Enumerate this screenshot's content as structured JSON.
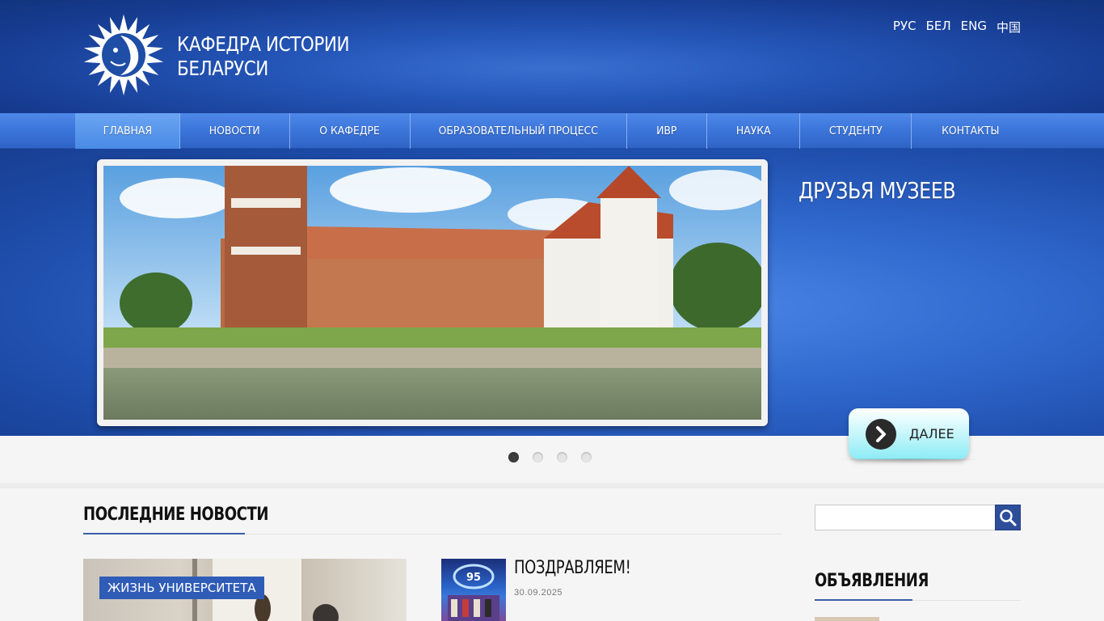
{
  "header": {
    "title_line1": "КАФЕДРА ИСТОРИИ",
    "title_line2": "БЕЛАРУСИ",
    "logo_icon": "sun-face-emblem-icon",
    "languages": [
      "РУС",
      "БЕЛ",
      "ENG",
      "中国"
    ]
  },
  "nav": {
    "items": [
      {
        "label": "ГЛАВНАЯ",
        "active": true
      },
      {
        "label": "НОВОСТИ"
      },
      {
        "label": "О КАФЕДРЕ"
      },
      {
        "label": "ОБРАЗОВАТЕЛЬНЫЙ ПРОЦЕСС"
      },
      {
        "label": "ИВР"
      },
      {
        "label": "НАУКА"
      },
      {
        "label": "СТУДЕНТУ"
      },
      {
        "label": "КОНТАКТЫ"
      }
    ]
  },
  "slider": {
    "title": "ДРУЗЬЯ МУЗЕЕВ",
    "image": "mir-castle-photo",
    "more_label": "ДАЛЕЕ",
    "more_icon": "chevron-right-icon",
    "slide_count": 4,
    "active_slide": 1
  },
  "news": {
    "section_title": "ПОСЛЕДНИЕ НОВОСТИ",
    "featured": {
      "tag": "ЖИЗНЬ УНИВЕРСИТЕТА",
      "image": "university-life-photo"
    },
    "items": [
      {
        "title": "ПОЗДРАВЛЯЕМ!",
        "date": "30.09.2025",
        "image": "anniversary-95-photo"
      }
    ]
  },
  "sidebar": {
    "search_placeholder": "",
    "search_icon": "search-icon",
    "announcements_title": "ОБЪЯВЛЕНИЯ"
  },
  "colors": {
    "header_blue": "#173d93",
    "nav_blue": "#3a73d8",
    "accent": "#2f5cb6",
    "button_cyan": "#8cecf6"
  }
}
